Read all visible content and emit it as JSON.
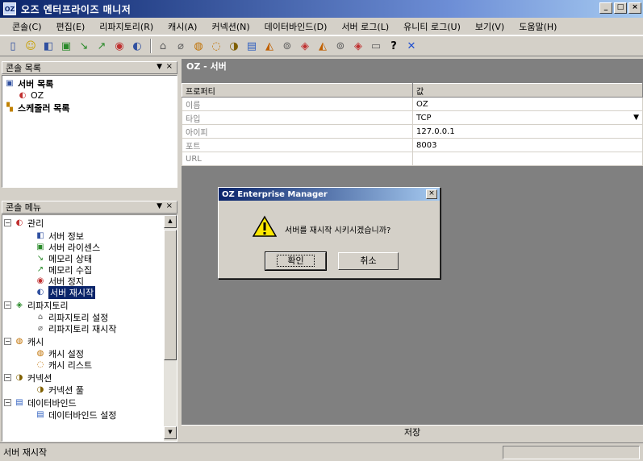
{
  "window": {
    "title": "오즈 엔터프라이즈 매니저",
    "icon_text": "OZ"
  },
  "menu": [
    "콘솔(C)",
    "편집(E)",
    "리파지토리(R)",
    "캐시(A)",
    "커넥션(N)",
    "데이터바인드(D)",
    "서버 로그(L)",
    "유니티 로그(U)",
    "보기(V)",
    "도움말(H)"
  ],
  "left_top_panel": {
    "header": "콘솔 목록",
    "items": [
      {
        "label": "서버 목록",
        "bold": true,
        "icon": "server-list-icon"
      },
      {
        "label": "OZ",
        "bold": false,
        "icon": "server-icon"
      },
      {
        "label": "스케줄러 목록",
        "bold": true,
        "icon": "scheduler-icon"
      }
    ]
  },
  "left_bottom_panel": {
    "header": "콘솔 메뉴",
    "items": [
      {
        "label": "관리",
        "group": true,
        "expander": "−"
      },
      {
        "label": "서버 정보"
      },
      {
        "label": "서버 라이센스"
      },
      {
        "label": "메모리 상태"
      },
      {
        "label": "메모리 수집"
      },
      {
        "label": "서버 정지"
      },
      {
        "label": "서버 재시작",
        "selected": true
      },
      {
        "label": "리파지토리",
        "group": true,
        "expander": "−"
      },
      {
        "label": "리파지토리 설정"
      },
      {
        "label": "리파지토리 재시작"
      },
      {
        "label": "캐시",
        "group": true,
        "expander": "−"
      },
      {
        "label": "캐시 설정"
      },
      {
        "label": "캐시 리스트"
      },
      {
        "label": "커넥션",
        "group": true,
        "expander": "−"
      },
      {
        "label": "커넥션 풀"
      },
      {
        "label": "데이터바인드",
        "group": true,
        "expander": "−"
      },
      {
        "label": "데이터바인드 설정"
      }
    ]
  },
  "document_tab": "OZ - 서버",
  "property_table": {
    "headers": [
      "프로퍼티",
      "값"
    ],
    "rows": [
      {
        "key": "이름",
        "value": "OZ"
      },
      {
        "key": "타입",
        "value": "TCP",
        "dropdown": true
      },
      {
        "key": "아이피",
        "value": "127.0.0.1"
      },
      {
        "key": "포트",
        "value": "8003"
      },
      {
        "key": "URL",
        "value": ""
      }
    ]
  },
  "bottom_tab": "저장",
  "dialog": {
    "title": "OZ Enterprise Manager",
    "message": "서버를 재시작 시키시겠습니까?",
    "ok_label": "확인",
    "cancel_label": "취소"
  },
  "status_text": "서버 재시작",
  "colors": {
    "titlebar": "#0a246a",
    "selection": "#0a246a",
    "workspace": "#808080",
    "chrome": "#d4d0c8"
  }
}
